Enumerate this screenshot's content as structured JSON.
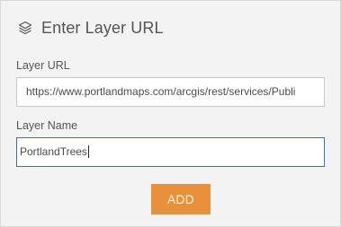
{
  "header": {
    "icon": "layers-icon",
    "title": "Enter Layer URL"
  },
  "layer_url": {
    "label": "Layer URL",
    "value": "https://www.portlandmaps.com/arcgis/rest/services/Publi"
  },
  "layer_name": {
    "label": "Layer Name",
    "value": "PortlandTrees"
  },
  "actions": {
    "add_label": "ADD",
    "add_color": "#e8913a"
  }
}
